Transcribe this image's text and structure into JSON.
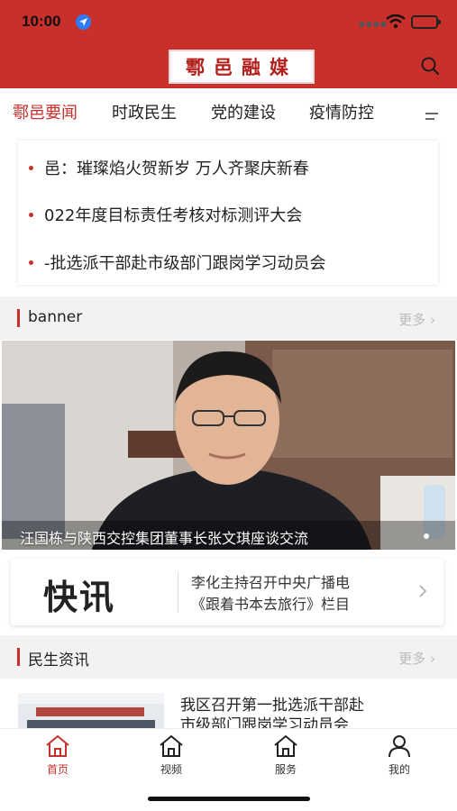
{
  "status_bar": {
    "time": "10:00"
  },
  "header": {
    "logo_text": "鄠邑融媒"
  },
  "tabs": [
    {
      "label": "鄠邑要闻",
      "active": true
    },
    {
      "label": "时政民生",
      "active": false
    },
    {
      "label": "党的建设",
      "active": false
    },
    {
      "label": "疫情防控",
      "active": false
    }
  ],
  "headlines": [
    "邑：璀璨焰火贺新岁 万人齐聚庆新春",
    "022年度目标责任考核对标测评大会",
    "-批选派干部赴市级部门跟岗学习动员会"
  ],
  "banner_section": {
    "title": "banner",
    "more": "更多",
    "caption": "汪国栋与陕西交控集团董事长张文琪座谈交流"
  },
  "flash_news": {
    "logo": "快讯",
    "lines": [
      "李化主持召开中央广播电",
      "《跟着书本去旅行》栏目"
    ]
  },
  "livelihood_section": {
    "title": "民生资讯",
    "more": "更多",
    "items": [
      {
        "title_line1": "我区召开第一批选派干部赴",
        "title_line2": "市级部门跟岗学习动员会"
      }
    ]
  },
  "bottom_nav": [
    {
      "label": "首页",
      "icon": "home-icon",
      "active": true
    },
    {
      "label": "视频",
      "icon": "video-icon",
      "active": false
    },
    {
      "label": "服务",
      "icon": "service-icon",
      "active": false
    },
    {
      "label": "我的",
      "icon": "profile-icon",
      "active": false
    }
  ],
  "colors": {
    "brand_red": "#c9302c"
  }
}
